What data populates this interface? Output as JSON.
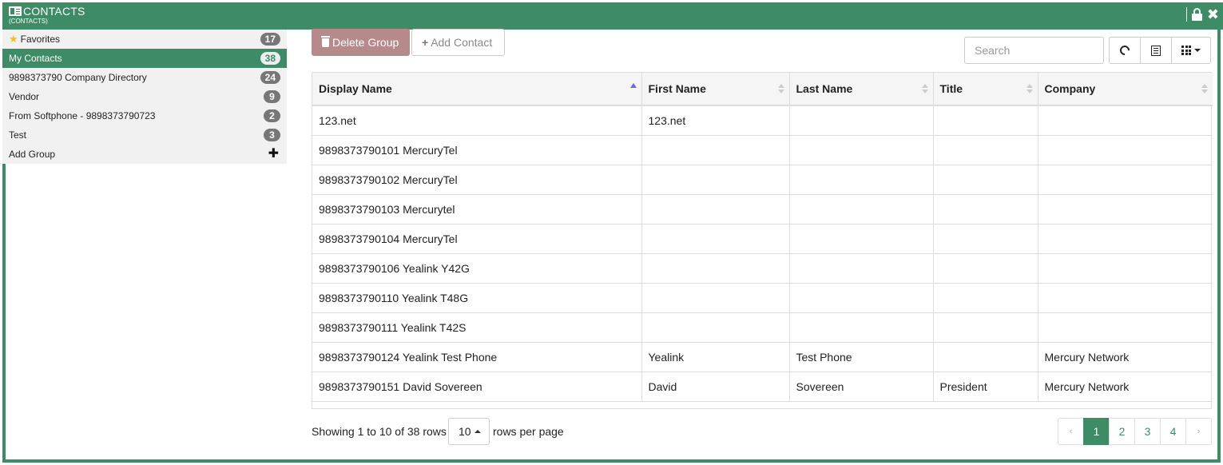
{
  "window": {
    "title": "CONTACTS",
    "subtitle": "(CONTACTS)"
  },
  "sidebar": {
    "groups": [
      {
        "label": "Favorites",
        "count": "17",
        "icon": "star-icon",
        "active": false
      },
      {
        "label": "My Contacts",
        "count": "38",
        "active": true
      },
      {
        "label": "9898373790 Company Directory",
        "count": "24",
        "active": false
      },
      {
        "label": "Vendor",
        "count": "9",
        "active": false
      },
      {
        "label": "From Softphone - 9898373790723",
        "count": "2",
        "active": false
      },
      {
        "label": "Test",
        "count": "3",
        "active": false
      }
    ],
    "add_group_label": "Add Group"
  },
  "toolbar": {
    "delete_group_label": "Delete Group",
    "add_contact_label": "Add Contact",
    "search_placeholder": "Search"
  },
  "table": {
    "columns": [
      "Display Name",
      "First Name",
      "Last Name",
      "Title",
      "Company"
    ],
    "rows": [
      [
        "123.net",
        "123.net",
        "",
        "",
        ""
      ],
      [
        "9898373790101 MercuryTel",
        "",
        "",
        "",
        ""
      ],
      [
        "9898373790102 MercuryTel",
        "",
        "",
        "",
        ""
      ],
      [
        "9898373790103 Mercurytel",
        "",
        "",
        "",
        ""
      ],
      [
        "9898373790104 MercuryTel",
        "",
        "",
        "",
        ""
      ],
      [
        "9898373790106 Yealink Y42G",
        "",
        "",
        "",
        ""
      ],
      [
        "9898373790110 Yealink T48G",
        "",
        "",
        "",
        ""
      ],
      [
        "9898373790111 Yealink T42S",
        "",
        "",
        "",
        ""
      ],
      [
        "9898373790124 Yealink Test Phone",
        "Yealink",
        "Test Phone",
        "",
        "Mercury Network"
      ],
      [
        "9898373790151 David Sovereen",
        "David",
        "Sovereen",
        "President",
        "Mercury Network"
      ]
    ]
  },
  "footer": {
    "showing_text": "Showing 1 to 10 of 38 rows",
    "per_page_value": "10",
    "rows_per_page_label": "rows per page"
  },
  "pagination": {
    "prev": "‹",
    "pages": [
      "1",
      "2",
      "3",
      "4"
    ],
    "active_page": "1",
    "next": "›"
  },
  "colors": {
    "accent": "#3d8c65",
    "delete_button": "#b68a8a"
  }
}
